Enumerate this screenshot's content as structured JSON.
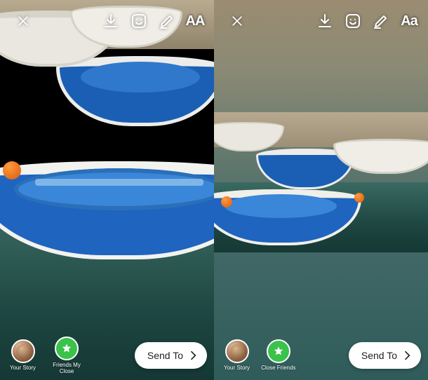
{
  "left": {
    "toolbar": {
      "text_label": "AA"
    },
    "destinations": {
      "your_story": "Your Story",
      "close_friends": "Friends My Close"
    },
    "send_to": "Send To"
  },
  "right": {
    "toolbar": {
      "text_label": "Aa"
    },
    "destinations": {
      "your_story": "Your Story",
      "close_friends": "Close Friends"
    },
    "send_to": "Send To"
  }
}
